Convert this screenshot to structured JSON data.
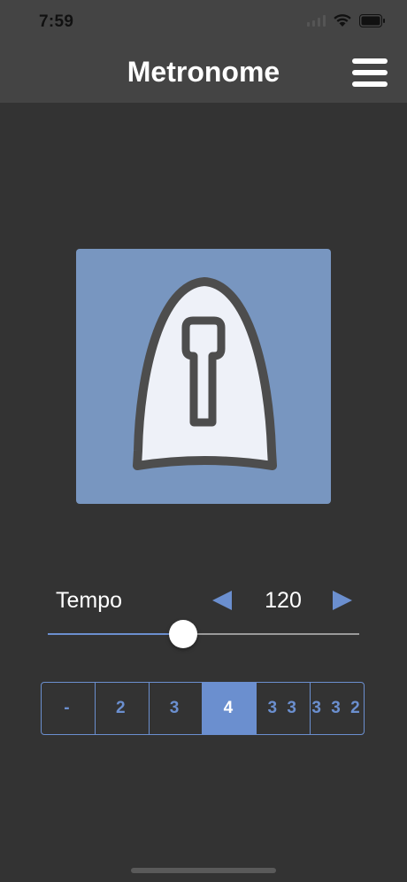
{
  "status_bar": {
    "time": "7:59"
  },
  "nav": {
    "title": "Metronome",
    "menu_icon": "hamburger-icon"
  },
  "artwork": {
    "icon": "metronome-icon",
    "background_color": "#7896c0"
  },
  "tempo": {
    "label": "Tempo",
    "value": "120",
    "decrease_icon": "triangle-left-icon",
    "increase_icon": "triangle-right-icon",
    "slider_level": 0.435
  },
  "time_signatures": {
    "options": [
      "-",
      "2",
      "3",
      "4",
      "3 3",
      "3 3 2"
    ],
    "selected": "4"
  },
  "colors": {
    "accent": "#6b8fcf",
    "background": "#333333",
    "header": "#444444"
  }
}
